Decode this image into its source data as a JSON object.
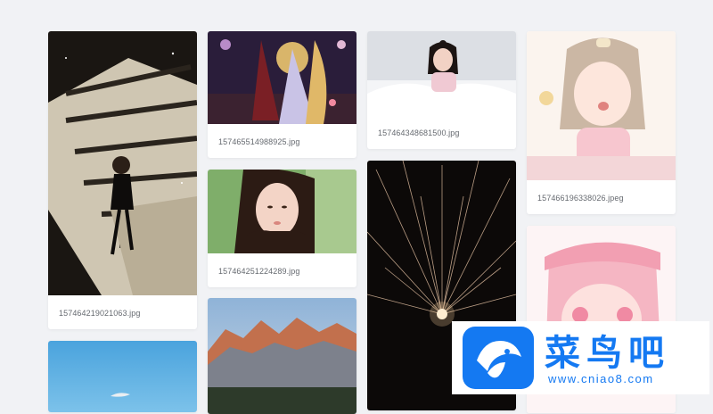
{
  "gallery": {
    "items": [
      {
        "file": "157464219021063.jpg"
      },
      {
        "file": ""
      },
      {
        "file": "157465514988925.jpg"
      },
      {
        "file": "157464251224289.jpg"
      },
      {
        "file": ""
      },
      {
        "file": "157464348681500.jpg"
      },
      {
        "file": ""
      },
      {
        "file": "157466196338026.jpeg"
      },
      {
        "file": ""
      }
    ]
  },
  "watermark": {
    "title": "菜鸟吧",
    "url": "www.cniao8.com",
    "logo_color": "#1479f2"
  },
  "colors": {
    "background": "#f1f2f5",
    "card": "#ffffff",
    "caption": "#666a70"
  }
}
